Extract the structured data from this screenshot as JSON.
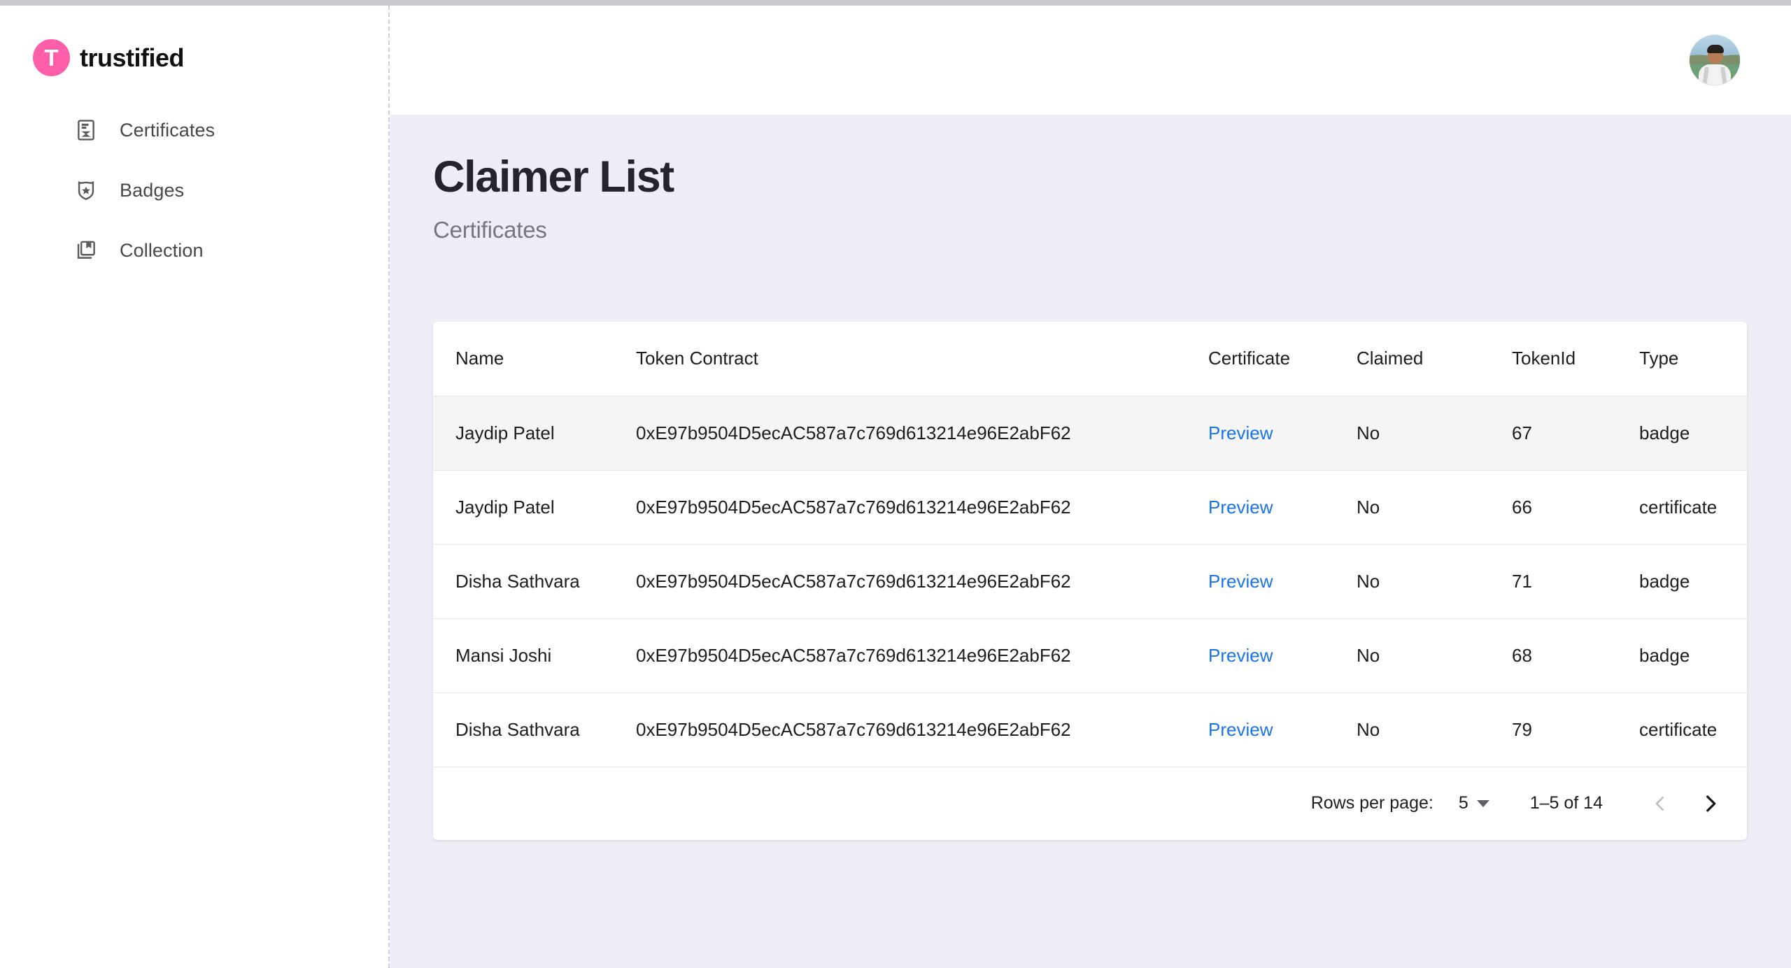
{
  "brand": {
    "mark_letter": "T",
    "name": "trustified"
  },
  "sidebar": {
    "items": [
      {
        "label": "Certificates",
        "icon": "certificate-document-icon"
      },
      {
        "label": "Badges",
        "icon": "badge-shield-star-icon"
      },
      {
        "label": "Collection",
        "icon": "collection-books-bookmark-icon"
      }
    ]
  },
  "topbar": {
    "avatar_alt": "user-avatar"
  },
  "page": {
    "title": "Claimer List",
    "subtitle": "Certificates"
  },
  "table": {
    "columns": [
      "Name",
      "Token Contract",
      "Certificate",
      "Claimed",
      "TokenId",
      "Type"
    ],
    "rows": [
      {
        "name": "Jaydip Patel",
        "token_contract": "0xE97b9504D5ecAC587a7c769d613214e96E2abF62",
        "certificate": "Preview",
        "claimed": "No",
        "token_id": "67",
        "type": "badge"
      },
      {
        "name": "Jaydip Patel",
        "token_contract": "0xE97b9504D5ecAC587a7c769d613214e96E2abF62",
        "certificate": "Preview",
        "claimed": "No",
        "token_id": "66",
        "type": "certificate"
      },
      {
        "name": "Disha Sathvara",
        "token_contract": "0xE97b9504D5ecAC587a7c769d613214e96E2abF62",
        "certificate": "Preview",
        "claimed": "No",
        "token_id": "71",
        "type": "badge"
      },
      {
        "name": "Mansi Joshi",
        "token_contract": "0xE97b9504D5ecAC587a7c769d613214e96E2abF62",
        "certificate": "Preview",
        "claimed": "No",
        "token_id": "68",
        "type": "badge"
      },
      {
        "name": "Disha Sathvara",
        "token_contract": "0xE97b9504D5ecAC587a7c769d613214e96E2abF62",
        "certificate": "Preview",
        "claimed": "No",
        "token_id": "79",
        "type": "certificate"
      }
    ]
  },
  "pagination": {
    "rows_per_page_label": "Rows per page:",
    "rows_per_page_value": "5",
    "range_label": "1–5 of 14",
    "prev_icon": "chevron-left-icon",
    "next_icon": "chevron-right-icon",
    "prev_enabled": false,
    "next_enabled": true
  },
  "colors": {
    "brand_pink": "#ff5fa8",
    "link_blue": "#1b74e4",
    "page_bg": "#eeeef8",
    "card_bg": "#ffffff",
    "row_hover": "#f5f5f6"
  }
}
